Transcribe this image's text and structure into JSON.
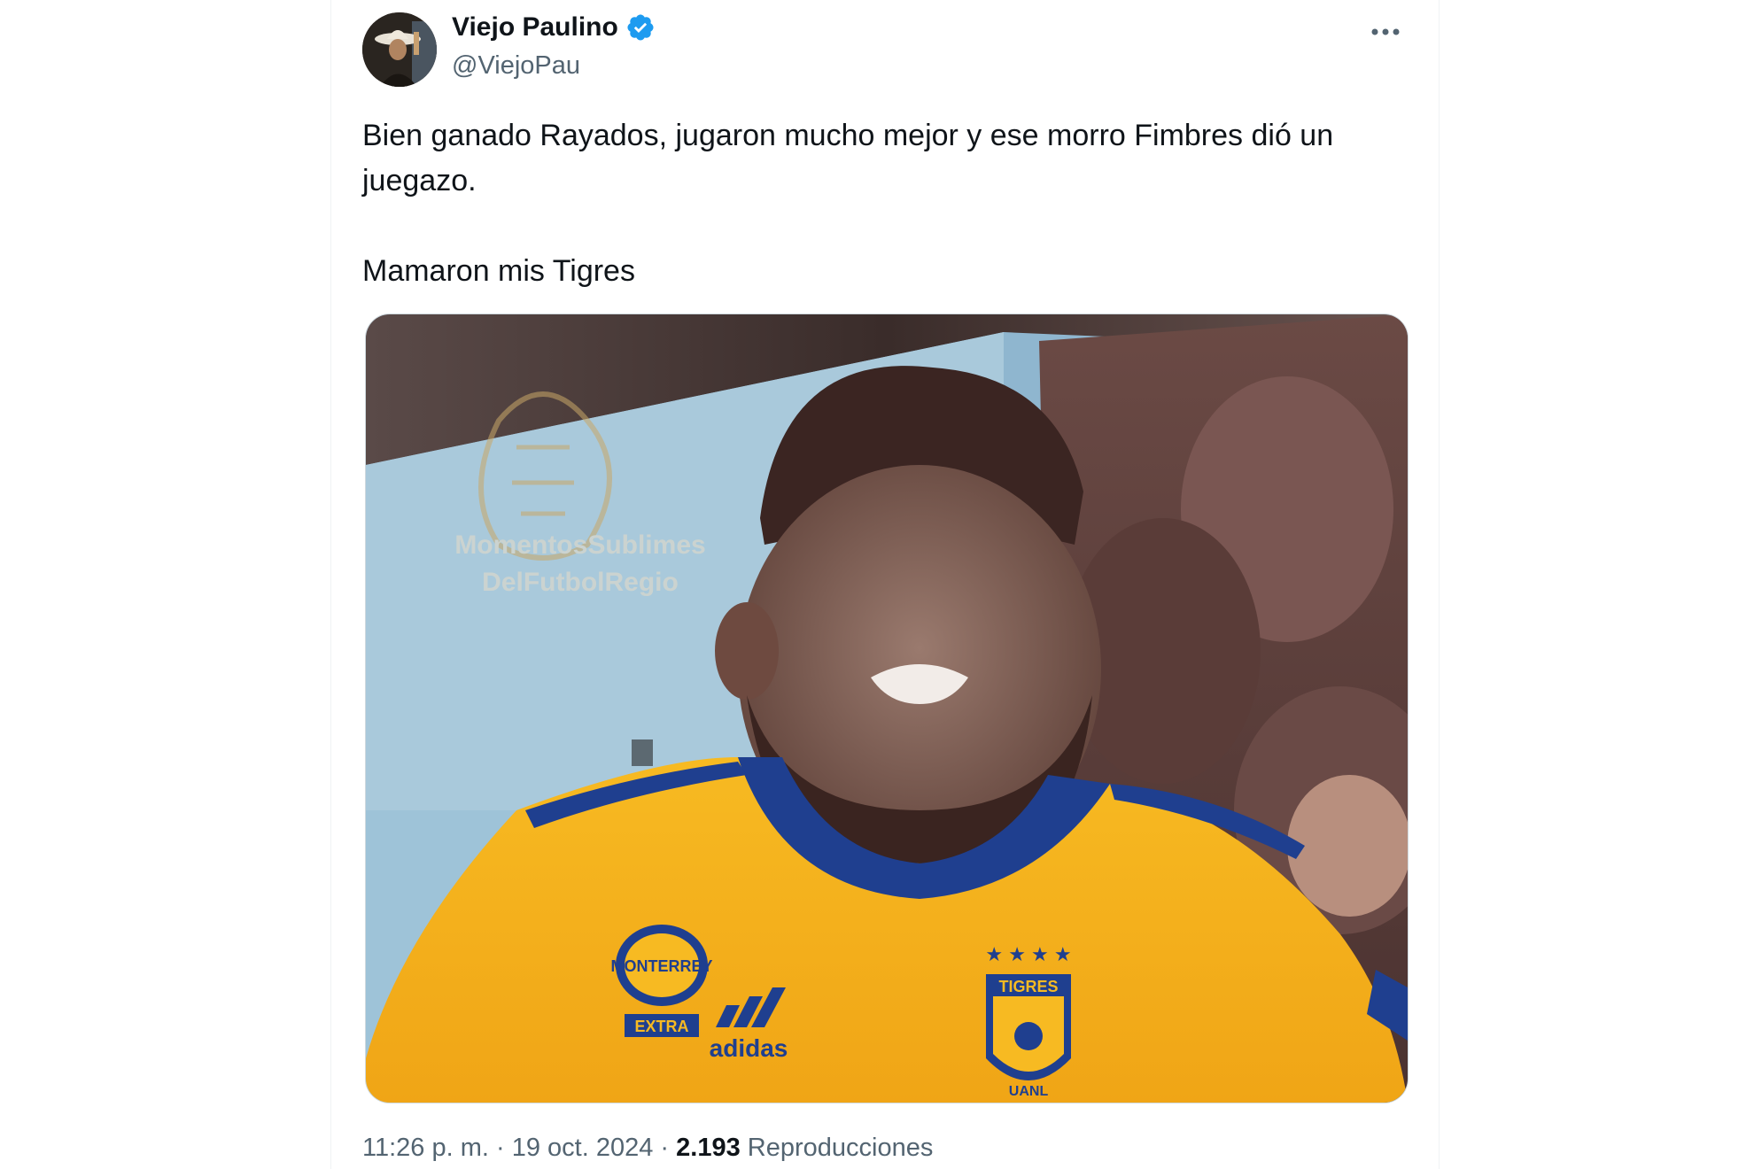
{
  "author": {
    "display_name": "Viejo Paulino",
    "handle": "@ViejoPau",
    "avatar_icon": "user-avatar-cowboy-hat",
    "verified_icon": "verified-badge-icon",
    "verified_color": "#1d9bf0"
  },
  "menu": {
    "icon": "more-horizontal-icon"
  },
  "tweet": {
    "text_line1": "Bien ganado Rayados, jugaron mucho mejor y ese morro Fimbres dió un juegazo.",
    "text_line2": "Mamaron mis Tigres"
  },
  "media": {
    "watermark_line1": "MomentosSublimes",
    "watermark_line2": "DelFutbolRegio",
    "jersey_sponsor": "MONTERREY",
    "jersey_sponsor_sub": "EXTRA",
    "jersey_brand": "adidas",
    "jersey_crest": "TIGRES",
    "jersey_crest_sub": "UANL",
    "jersey_color": "#f5b320"
  },
  "footer": {
    "time": "11:26 p. m.",
    "separator1": " · ",
    "date": "19 oct. 2024",
    "separator2": " · ",
    "views_count": "2.193",
    "views_label": "Reproducciones"
  }
}
